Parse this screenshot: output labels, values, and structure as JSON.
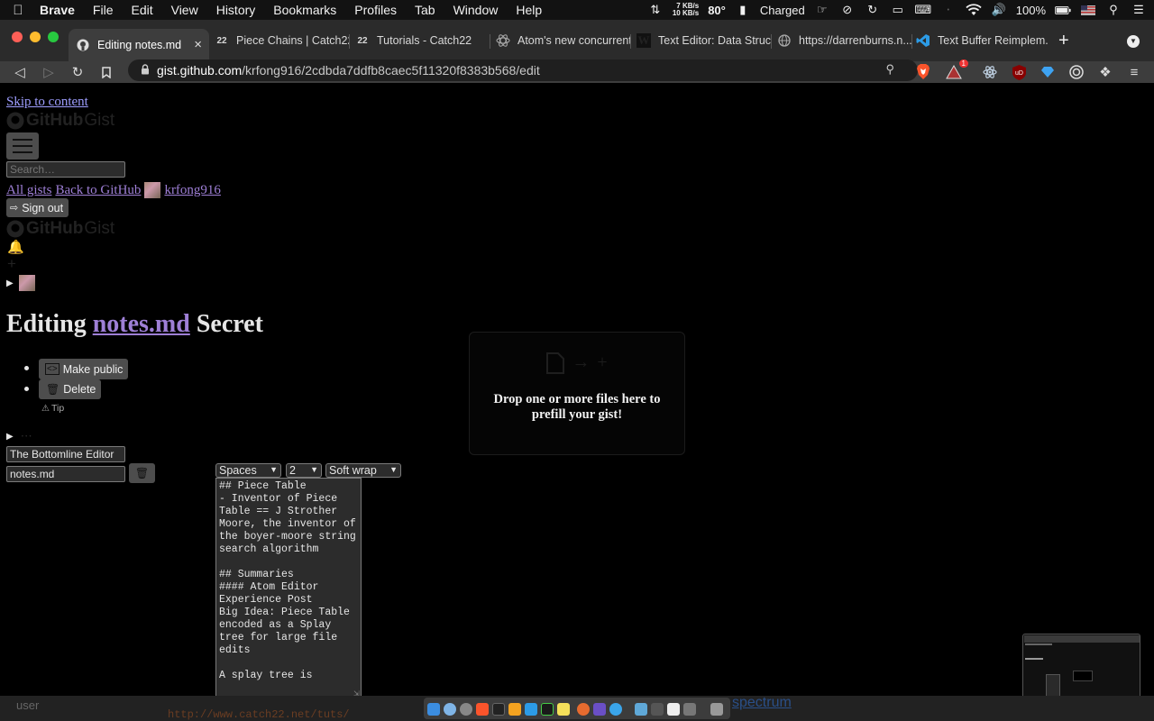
{
  "menubar": {
    "app": "Brave",
    "items": [
      "File",
      "Edit",
      "View",
      "History",
      "Bookmarks",
      "Profiles",
      "Tab",
      "Window",
      "Help"
    ],
    "net_up": "7 KB/s",
    "net_down": "10 KB/s",
    "temp": "80°",
    "battery_status": "Charged",
    "battery_pct": "100%"
  },
  "tabs": [
    {
      "title": "Editing notes.md",
      "icon": "github-icon",
      "active": true
    },
    {
      "title": "Piece Chains | Catch22",
      "icon": "22"
    },
    {
      "title": "Tutorials - Catch22",
      "icon": "22"
    },
    {
      "title": "Atom's new concurrent...",
      "icon": "atom-icon"
    },
    {
      "title": "Text Editor: Data Struc...",
      "icon": "wiki-icon"
    },
    {
      "title": "https://darrenburns.n...",
      "icon": "globe-icon"
    },
    {
      "title": "Text Buffer Reimplem...",
      "icon": "vscode-icon"
    }
  ],
  "url": {
    "host": "gist.github.com",
    "path": "/krfong916/2cdbda7ddfb8caec5f11320f8383b568/edit"
  },
  "brave_badge": "1",
  "page": {
    "skip_link": "Skip to content",
    "logo_text": "GitHub",
    "logo_suffix": "Gist",
    "search_placeholder": "Search…",
    "nav": {
      "all_gists": "All gists",
      "back": "Back to GitHub",
      "user": "krfong916"
    },
    "sign_out": "Sign out",
    "plus": "+",
    "title_prefix": "Editing",
    "title_file": "notes.md",
    "title_suffix": "Secret",
    "make_public": "Make public",
    "delete": "Delete",
    "tip": "Tip",
    "ellipsis": "···",
    "description_value": "The Bottomline Editor",
    "filename_value": "notes.md",
    "indent_mode": "Spaces",
    "indent_size": "2",
    "wrap_mode": "Soft wrap",
    "editor_text": "## Piece Table\n- Inventor of Piece Table == J Strother Moore, the inventor of the boyer-moore string search algorithm\n\n## Summaries\n#### Atom Editor Experience Post\nBig Idea: Piece Table encoded as a Splay tree for large file edits\n\nA splay tree is",
    "dropzone_text": "Drop one or more files here to prefill your gist!"
  },
  "dock": {
    "left_text": "user",
    "url_hint": "http://www.catch22.net/tuts/",
    "right_text": "spectrum"
  }
}
